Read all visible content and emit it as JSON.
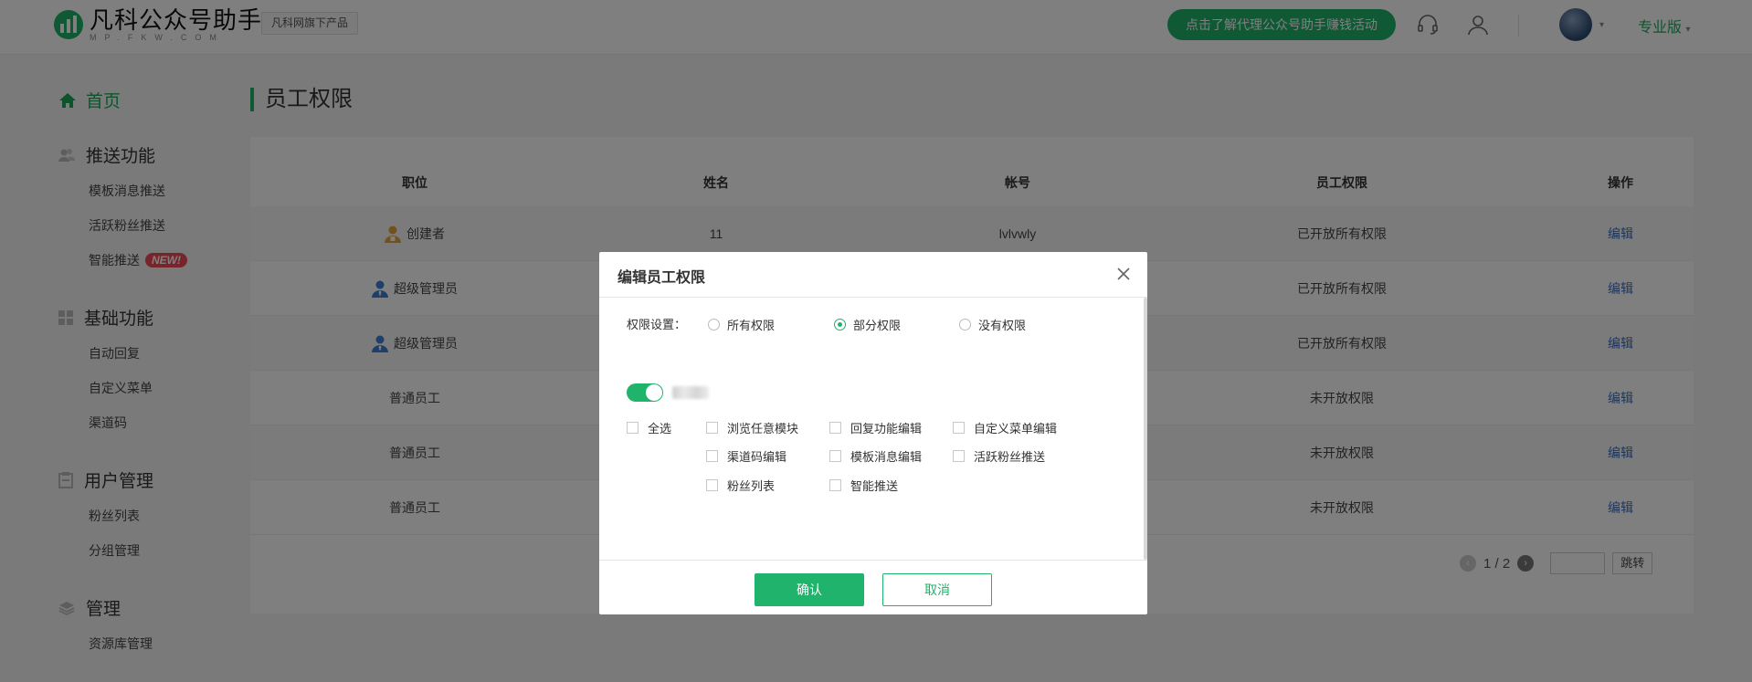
{
  "header": {
    "logo_title": "凡科公众号助手",
    "logo_sub": "MP.FKW.COM",
    "brand_tag": "凡科网旗下产品",
    "promo": "点击了解代理公众号助手赚钱活动",
    "edition": "专业版"
  },
  "sidebar": {
    "home": "首页",
    "groups": [
      {
        "title": "推送功能",
        "icon": "users-icon",
        "items": [
          "模板消息推送",
          "活跃粉丝推送",
          "智能推送"
        ]
      },
      {
        "title": "基础功能",
        "icon": "grid-icon",
        "items": [
          "自动回复",
          "自定义菜单",
          "渠道码"
        ]
      },
      {
        "title": "用户管理",
        "icon": "clipboard-icon",
        "items": [
          "粉丝列表",
          "分组管理"
        ]
      },
      {
        "title": "管理",
        "icon": "layers-icon",
        "items": [
          "资源库管理"
        ]
      }
    ],
    "new_badge": "NEW!"
  },
  "main": {
    "title": "员工权限",
    "columns": [
      "职位",
      "姓名",
      "帐号",
      "员工权限",
      "操作"
    ],
    "rows": [
      {
        "role": "创建者",
        "role_icon": "creator-icon",
        "name": "11",
        "account": "lvlvwly",
        "perm": "已开放所有权限",
        "action": "编辑"
      },
      {
        "role": "超级管理员",
        "role_icon": "admin-icon",
        "name": "",
        "account": "",
        "perm": "已开放所有权限",
        "action": "编辑"
      },
      {
        "role": "超级管理员",
        "role_icon": "admin-icon",
        "name": "",
        "account": "",
        "perm": "已开放所有权限",
        "action": "编辑"
      },
      {
        "role": "普通员工",
        "role_icon": "",
        "name": "",
        "account": "",
        "perm": "未开放权限",
        "action": "编辑"
      },
      {
        "role": "普通员工",
        "role_icon": "",
        "name": "",
        "account": "",
        "perm": "未开放权限",
        "action": "编辑"
      },
      {
        "role": "普通员工",
        "role_icon": "",
        "name": "",
        "account": "",
        "perm": "未开放权限",
        "action": "编辑"
      }
    ],
    "pager": {
      "text": "1 / 2",
      "jump": "跳转"
    }
  },
  "modal": {
    "title": "编辑员工权限",
    "perm_label": "权限设置：",
    "radios": [
      {
        "label": "所有权限",
        "checked": false
      },
      {
        "label": "部分权限",
        "checked": true
      },
      {
        "label": "没有权限",
        "checked": false
      }
    ],
    "select_all": "全选",
    "checkboxes": [
      "浏览任意模块",
      "回复功能编辑",
      "自定义菜单编辑",
      "渠道码编辑",
      "模板消息编辑",
      "活跃粉丝推送",
      "粉丝列表",
      "智能推送"
    ],
    "ok": "确认",
    "cancel": "取消"
  },
  "colors": {
    "accent": "#1fb36b",
    "link": "#2f6fd0",
    "badge": "#ef4b55"
  }
}
